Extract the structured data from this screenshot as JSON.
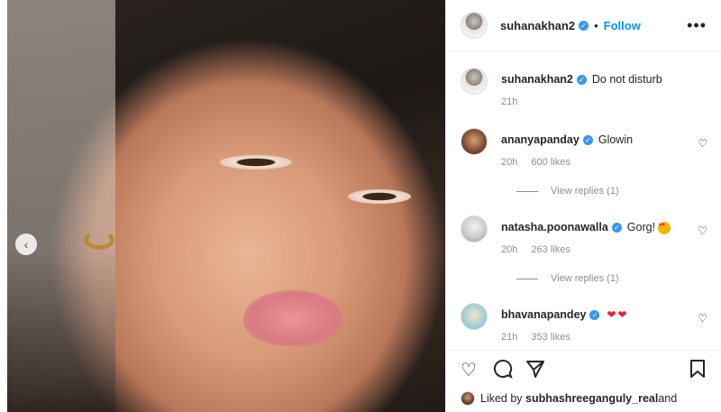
{
  "post": {
    "author": "suhanakhan2",
    "follow_label": "Follow",
    "more_label": "•••",
    "carousel_prev_label": "‹"
  },
  "caption": {
    "user": "suhanakhan2",
    "text": "Do not disturb",
    "time": "21h"
  },
  "comments": [
    {
      "user": "ananyapanday",
      "text": "Glowin",
      "time": "20h",
      "likes": "600 likes",
      "replies": "View replies (1)",
      "emoji": ""
    },
    {
      "user": "natasha.poonawalla",
      "text": "Gorg!",
      "time": "20h",
      "likes": "263 likes",
      "replies": "View replies (1)",
      "emoji": "heart-eyes"
    },
    {
      "user": "bhavanapandey",
      "text": "",
      "time": "21h",
      "likes": "353 likes",
      "replies": "",
      "emoji": "red-hearts"
    }
  ],
  "likes_bar": {
    "prefix": "Liked by ",
    "user": "subhashreeganguly_real",
    "suffix": " and"
  },
  "icons": {
    "like": "heart-icon",
    "comment": "comment-icon",
    "share": "share-icon",
    "save": "bookmark-icon"
  },
  "colors": {
    "accent": "#0095f6",
    "verified": "#3897f0",
    "heart": "#e0223b"
  }
}
